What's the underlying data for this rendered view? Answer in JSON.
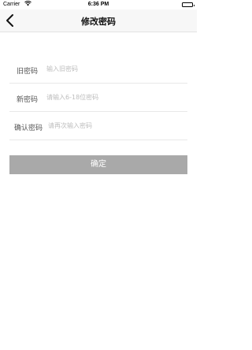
{
  "status_bar": {
    "carrier": "Carrier",
    "time": "6:36 PM"
  },
  "nav": {
    "title": "修改密码",
    "back_icon": "chevron-left-icon"
  },
  "form": {
    "old_password": {
      "label": "旧密码",
      "placeholder": "输入旧密码",
      "value": ""
    },
    "new_password": {
      "label": "新密码",
      "placeholder": "请输入6-18位密码",
      "value": ""
    },
    "confirm_password": {
      "label": "确认密码",
      "placeholder": "请再次输入密码",
      "value": ""
    }
  },
  "actions": {
    "confirm_label": "确定"
  },
  "colors": {
    "button_bg": "#a9a9a9",
    "nav_bg": "#f7f7f7",
    "placeholder": "#bdbdbd"
  }
}
